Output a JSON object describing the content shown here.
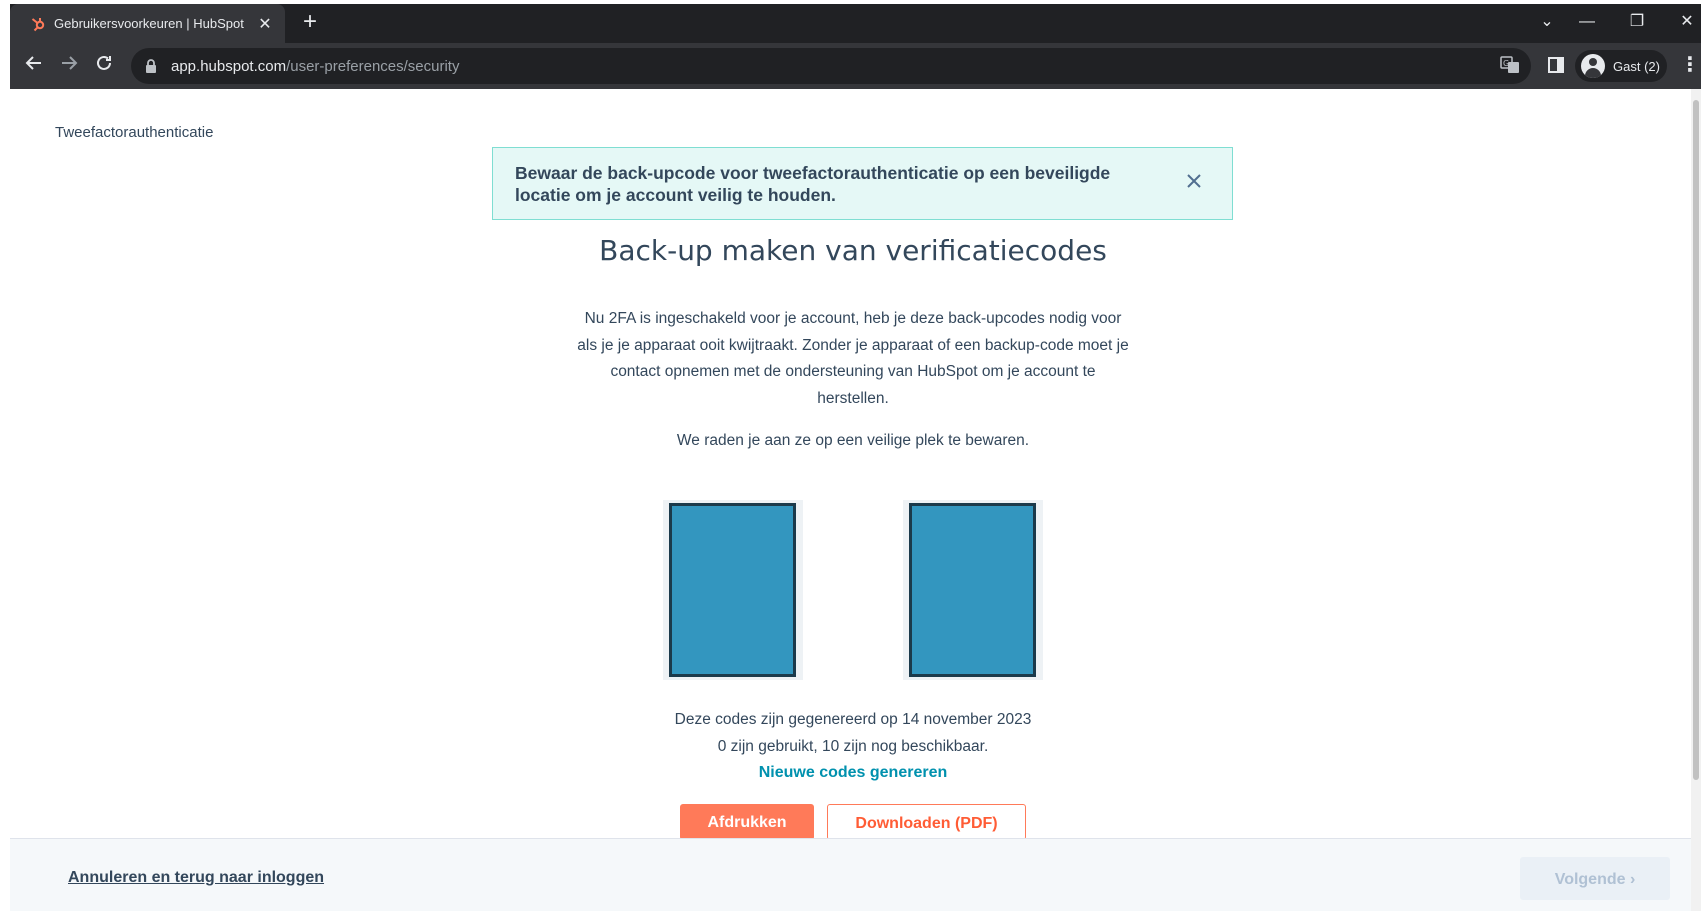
{
  "browser": {
    "tab_title": "Gebruikersvoorkeuren | HubSpot",
    "tab_close": "✕",
    "new_tab": "+",
    "url_host": "app.hubspot.com",
    "url_path": "/user-preferences/security",
    "profile_label": "Gast (2)",
    "window_controls": [
      "⌄",
      "—",
      "❐",
      "✕"
    ]
  },
  "page": {
    "breadcrumb": "Tweefactorauthenticatie",
    "alert_message": "Bewaar de back-upcode voor tweefactorauthenticatie op een beveiligde locatie om je account veilig te houden.",
    "heading": "Back-up maken van verificatiecodes",
    "paragraph": "Nu 2FA is ingeschakeld voor je account, heb je deze back-upcodes nodig voor als je je apparaat ooit kwijtraakt. Zonder je apparaat of een backup-code moet je contact opnemen met de ondersteuning van HubSpot om je account te herstellen.",
    "paragraph2": "We raden je aan ze op een veilige plek te bewaren.",
    "generated_on": "Deze codes zijn gegenereerd op 14 november 2023",
    "usage": "0 zijn gebruikt, 10 zijn nog beschikbaar.",
    "new_codes_link": "Nieuwe codes genereren",
    "print_button": "Afdrukken",
    "pdf_button": "Downloaden (PDF)"
  },
  "footer": {
    "cancel_link": "Annuleren en terug naar inloggen",
    "next_button": "Volgende ›"
  },
  "colors": {
    "accent_orange": "#ff7a59",
    "link_teal": "#0091ae",
    "alert_bg": "#e5f8f6",
    "code_block": "#3396bf"
  }
}
